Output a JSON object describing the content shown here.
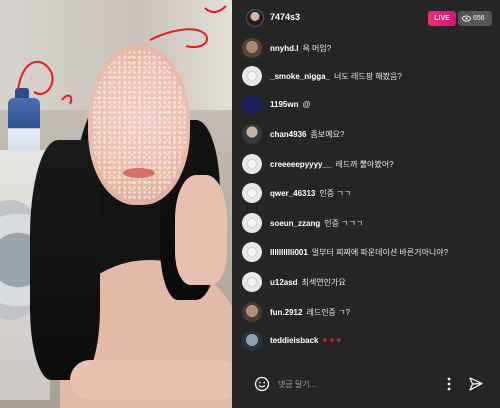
{
  "stream": {
    "host_name": "7474s3",
    "live_label": "LIVE",
    "viewer_count": "656"
  },
  "comments": [
    {
      "user": "nnyhd.l",
      "text": "욕 머임?",
      "avatar": "photo"
    },
    {
      "user": "_smoke_nigga_",
      "text": "너도 레드팡 해봤음?",
      "avatar": "default"
    },
    {
      "user": "1195wn",
      "text": "@",
      "avatar": "navy"
    },
    {
      "user": "chan4936",
      "text": "좀보예요?",
      "avatar": "photo"
    },
    {
      "user": "creeeeepyyyy__",
      "text": "레드꺼 뿔아봤어?",
      "avatar": "default"
    },
    {
      "user": "qwer_46313",
      "text": "인증 ㄱㄱ",
      "avatar": "default"
    },
    {
      "user": "soeun_zzang",
      "text": "인증 ㄱㄱㄱ",
      "avatar": "default"
    },
    {
      "user": "lllllllllli001",
      "text": "얼부터 찌찌에 파운데이션 바른거아니야?",
      "avatar": "default"
    },
    {
      "user": "u12asd",
      "text": "최섹연인가요",
      "avatar": "default"
    },
    {
      "user": "fun.2912",
      "text": "레드인증 ㄱ?",
      "avatar": "photo"
    },
    {
      "user": "teddieisback",
      "text": "♥ ♥ ♥",
      "avatar": "photo"
    }
  ],
  "footer": {
    "comment_placeholder": "댓글 달기..."
  },
  "colors": {
    "panel_bg": "#262626",
    "live_badge": "#e0206f",
    "heart": "#e0242f",
    "scribble": "#e01e1e"
  },
  "icons": [
    "eye-icon",
    "emoji-icon",
    "more-icon",
    "send-icon"
  ]
}
